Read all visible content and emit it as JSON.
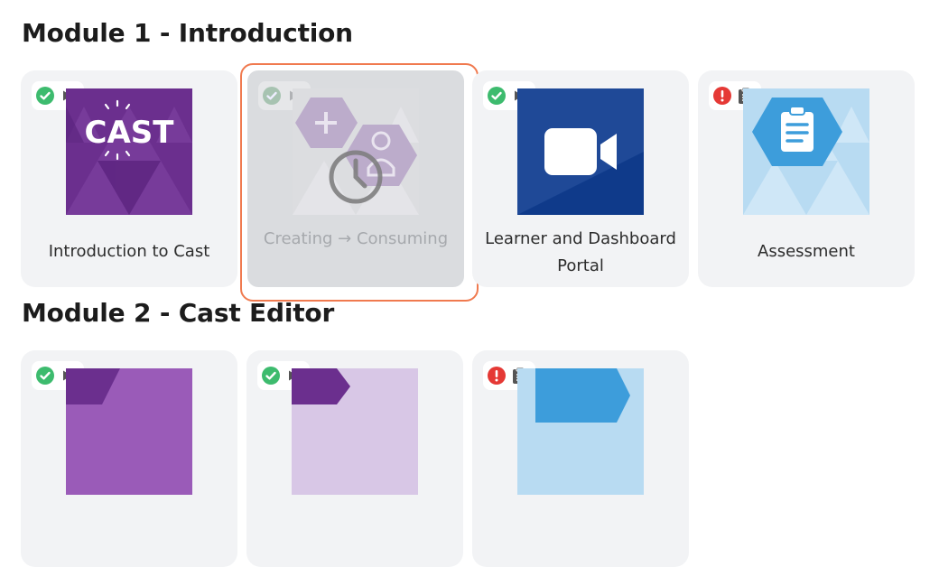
{
  "modules": [
    {
      "title": "Module 1 - Introduction",
      "cards": [
        {
          "label": "Introduction to Cast",
          "status": "complete",
          "type": "video"
        },
        {
          "label": "Creating → Consuming",
          "status": "complete",
          "type": "video",
          "state": "loading"
        },
        {
          "label": "Learner and Dashboard Portal",
          "status": "complete",
          "type": "video"
        },
        {
          "label": "Assessment",
          "status": "incomplete",
          "type": "assessment"
        }
      ]
    },
    {
      "title": "Module 2 - Cast Editor",
      "cards": [
        {
          "status": "complete",
          "type": "video"
        },
        {
          "status": "complete",
          "type": "video"
        },
        {
          "status": "incomplete",
          "type": "assessment"
        }
      ]
    }
  ],
  "thumbnail_text": {
    "cast_logo": "CAST"
  },
  "colors": {
    "complete_green": "#3dbb6e",
    "error_red": "#e53935",
    "selection_orange": "#f07a4f",
    "purple": "#6b2f8e",
    "navy": "#0f3a8a",
    "light_blue": "#b8dbf2",
    "accent_blue": "#3d9ddb"
  }
}
